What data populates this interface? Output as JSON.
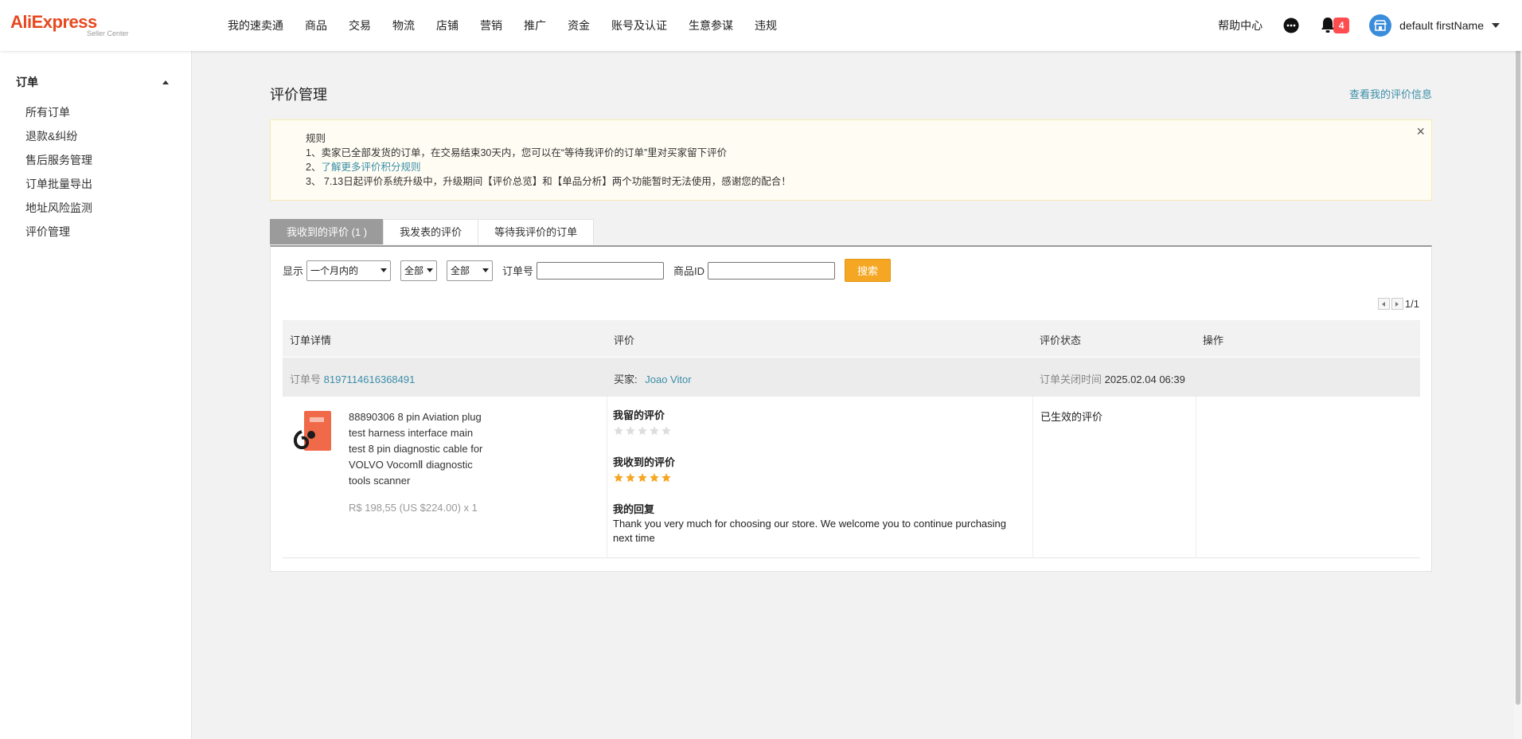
{
  "brand": {
    "logo_text": "AliExpress",
    "logo_sub": "Seller Center",
    "logo_color": "#e8481f"
  },
  "nav": {
    "items": [
      "我的速卖通",
      "商品",
      "交易",
      "物流",
      "店铺",
      "营销",
      "推广",
      "资金",
      "账号及认证",
      "生意参谋",
      "违规"
    ]
  },
  "header": {
    "help": "帮助中心",
    "chat_icon": "chat-bubble-icon",
    "bell_icon": "bell-icon",
    "notification_count": "4",
    "user_name": "default firstName"
  },
  "sidebar": {
    "section": "订单",
    "items": [
      "所有订单",
      "退款&纠纷",
      "售后服务管理",
      "订单批量导出",
      "地址风险监测",
      "评价管理"
    ]
  },
  "page": {
    "title": "评价管理",
    "view_info_link": "查看我的评价信息"
  },
  "rules": {
    "heading": "规则",
    "line1": "1、卖家已全部发货的订单，在交易结束30天内，您可以在“等待我评价的订单”里对买家留下评价",
    "line2_prefix": "2、",
    "line2_link": "了解更多评价积分规则",
    "line3": "3、 7.13日起评价系统升级中，升级期间【评价总览】和【单品分析】两个功能暂时无法使用，感谢您的配合！"
  },
  "tabs": [
    "我收到的评价 (1 )",
    "我发表的评价",
    "等待我评价的订单"
  ],
  "filters": {
    "show_label": "显示",
    "period": "一个月内的",
    "filter1": "全部",
    "filter2": "全部",
    "order_label": "订单号",
    "order_value": "",
    "product_label": "商品ID",
    "product_value": "",
    "search_button": "搜索"
  },
  "pager": {
    "text": "1/1"
  },
  "table": {
    "headers": [
      "订单详情",
      "评价",
      "评价状态",
      "操作"
    ],
    "order": {
      "order_label": "订单号",
      "order_id": "8197114616368491",
      "buyer_label": "买家:",
      "buyer_name": "Joao Vitor",
      "close_label": "订单关闭时间",
      "close_time": "2025.02.04 06:39"
    },
    "product": {
      "title": "88890306 8 pin Aviation plug test harness interface main test 8 pin diagnostic cable for VOLVO VocomⅡ diagnostic tools scanner",
      "price": "R$ 198,55 (US $224.00) x 1"
    },
    "evaluation": {
      "my_eval_label": "我留的评价",
      "my_eval_rating": 0,
      "received_label": "我收到的评价",
      "received_rating": 5,
      "reply_label": "我的回复",
      "reply_text": "Thank you very much for choosing our store. We welcome you to continue purchasing next time"
    },
    "status": "已生效的评价"
  },
  "colors": {
    "accent_link": "#3b8ea8",
    "search_button": "#f5a623",
    "star_filled": "#f5a623",
    "star_empty": "#dddddd",
    "badge": "#ff4d4f"
  }
}
